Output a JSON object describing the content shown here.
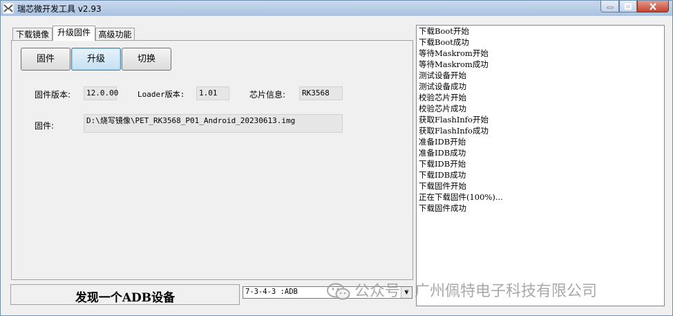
{
  "window": {
    "title": "瑞芯微开发工具 v2.93"
  },
  "tabs": [
    {
      "label": "下载镜像"
    },
    {
      "label": "升级固件"
    },
    {
      "label": "高级功能"
    }
  ],
  "buttons": {
    "firmware": "固件",
    "upgrade": "升级",
    "switch": "切换"
  },
  "info": {
    "firmware_version_label": "固件版本:",
    "firmware_version": "12.0.00",
    "loader_version_label": "Loader版本:",
    "loader_version": "1.01",
    "chip_info_label": "芯片信息:",
    "chip_info": "RK3568",
    "firmware_path_label": "固件:",
    "firmware_path": "D:\\烧写镜像\\PET_RK3568_P01_Android_20230613.img"
  },
  "log": [
    "下载Boot开始",
    "下载Boot成功",
    "等待Maskrom开始",
    "等待Maskrom成功",
    "测试设备开始",
    "测试设备成功",
    "校验芯片开始",
    "校验芯片成功",
    "获取FlashInfo开始",
    "获取FlashInfo成功",
    "准备IDB开始",
    "准备IDB成功",
    "下载IDB开始",
    "下载IDB成功",
    "下载固件开始",
    "正在下载固件(100%)...",
    "下载固件成功"
  ],
  "status": {
    "text": "发现一个ADB设备"
  },
  "device_select": {
    "value": "7-3-4-3 :ADB"
  },
  "watermark": {
    "text": "公众号 · 广州佩特电子科技有限公司"
  },
  "colors": {
    "title_bar": "#b7cce6",
    "close_button": "#c4452f",
    "focus_button": "#c4e0f4"
  }
}
